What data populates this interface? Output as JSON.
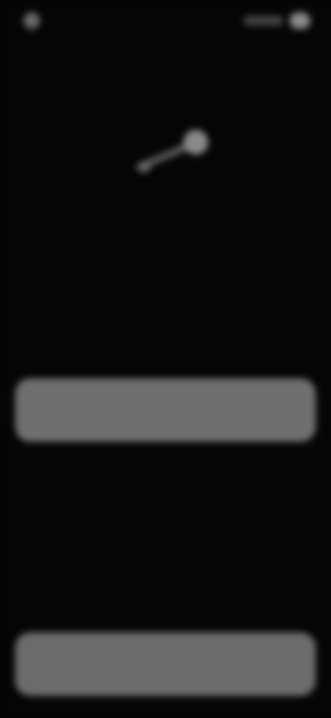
{
  "status_bar": {
    "time": "",
    "icons": [
      "camera-dot-icon",
      "signal-bars-icon",
      "battery-icon"
    ]
  },
  "header": {
    "title": ""
  },
  "hero": {
    "icon": "key-icon"
  },
  "description": {
    "text": ""
  },
  "primary_button": {
    "label": ""
  },
  "bottom_button": {
    "label": ""
  },
  "colors": {
    "background": "#050505",
    "button": "#6f6f6f",
    "text": "#8a8a8a"
  }
}
